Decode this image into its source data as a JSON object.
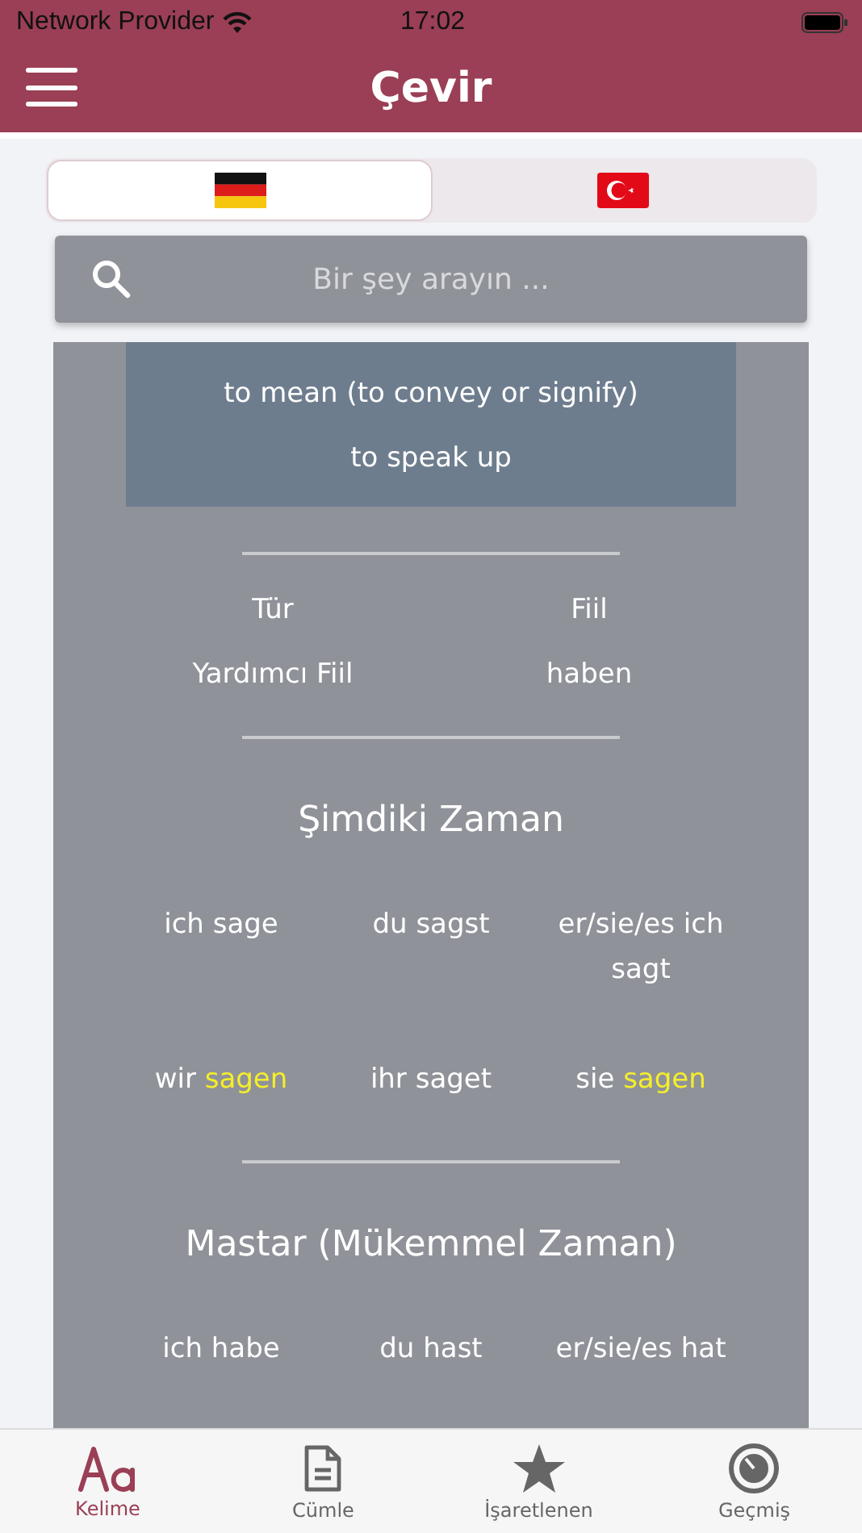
{
  "status_bar": {
    "carrier": "Network Provider",
    "time": "17:02"
  },
  "header": {
    "title": "Çevir"
  },
  "language_tabs": [
    {
      "kind": "de",
      "selected": true
    },
    {
      "kind": "tr",
      "selected": false
    }
  ],
  "search": {
    "placeholder": "Bir şey arayın ..."
  },
  "meanings": [
    "to mean (to convey or signify)",
    "to speak up"
  ],
  "details": [
    {
      "label": "Tür",
      "value": "Fiil"
    },
    {
      "label": "Yardımcı Fiil",
      "value": "haben"
    }
  ],
  "sections": [
    {
      "title": "Şimdiki Zaman",
      "forms": [
        {
          "pronoun": "ich",
          "verb": "sage",
          "highlight": false
        },
        {
          "pronoun": "du",
          "verb": "sagst",
          "highlight": false
        },
        {
          "pronoun": "er/sie/es ich",
          "verb": "sagt",
          "highlight": false
        },
        {
          "pronoun": "wir",
          "verb": "sagen",
          "highlight": true
        },
        {
          "pronoun": "ihr",
          "verb": "saget",
          "highlight": false
        },
        {
          "pronoun": "sie",
          "verb": "sagen",
          "highlight": true
        }
      ]
    },
    {
      "title": "Mastar (Mükemmel Zaman)",
      "forms": [
        {
          "pronoun": "ich",
          "verb": "habe",
          "highlight": false
        },
        {
          "pronoun": "du",
          "verb": "hast",
          "highlight": false
        },
        {
          "pronoun": "er/sie/es",
          "verb": "hat",
          "highlight": false
        }
      ]
    }
  ],
  "tab_bar": [
    {
      "kind": "word",
      "label": "Kelime",
      "selected": true
    },
    {
      "kind": "sentence",
      "label": "Cümle",
      "selected": false
    },
    {
      "kind": "starred",
      "label": "İşaretlenen",
      "selected": false
    },
    {
      "kind": "history",
      "label": "Geçmiş",
      "selected": false
    }
  ]
}
